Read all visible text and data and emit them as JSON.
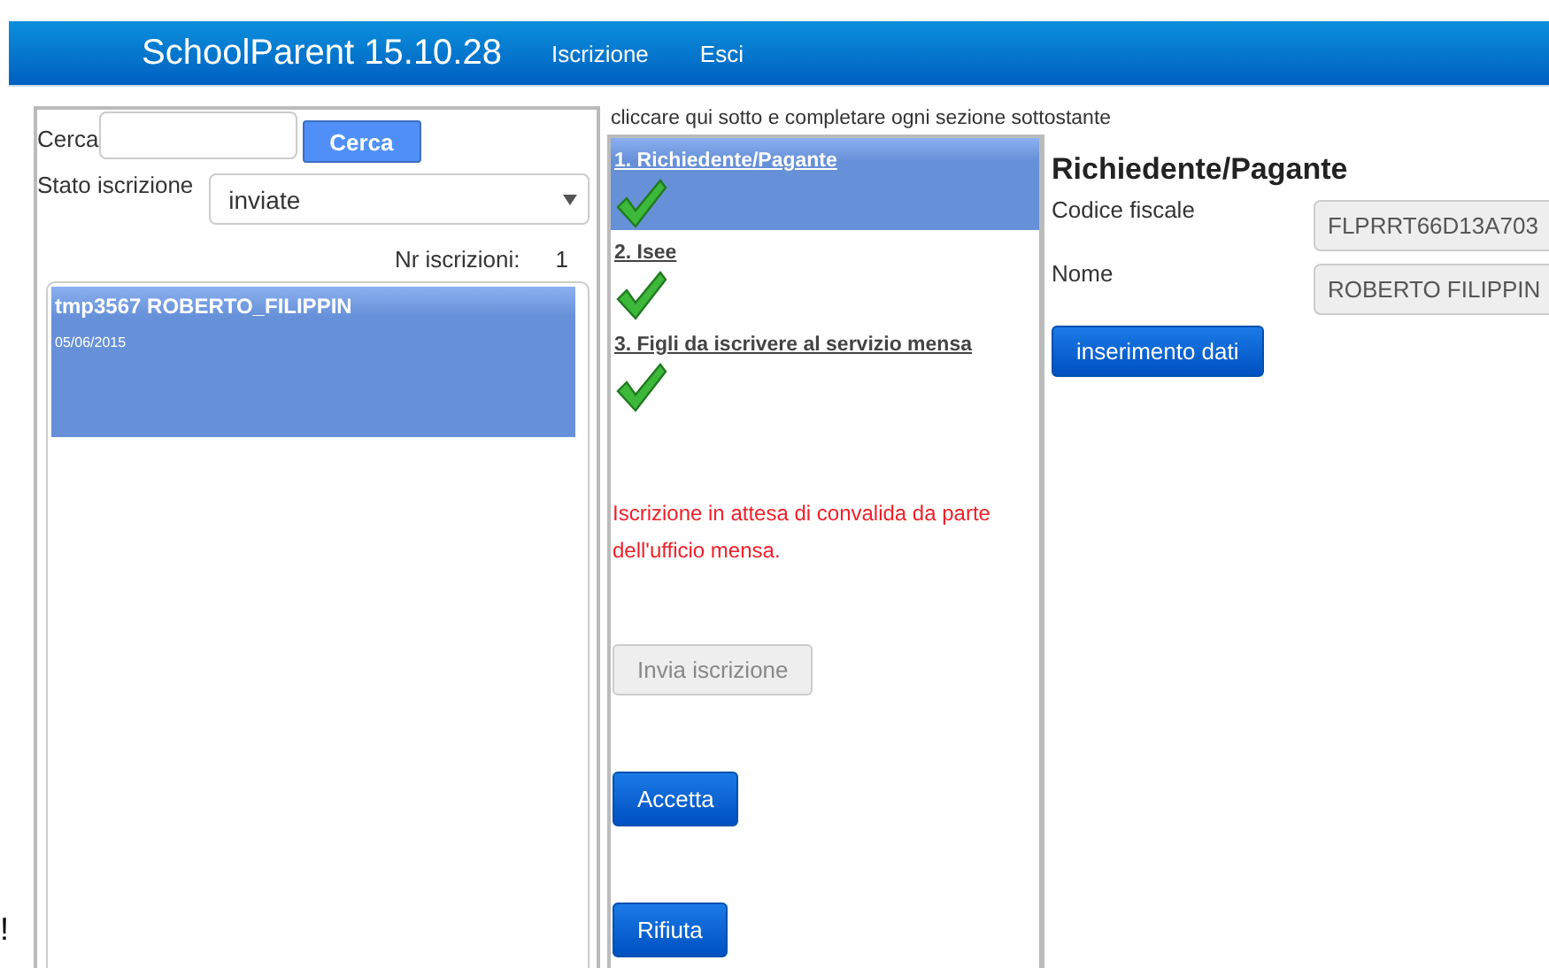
{
  "header": {
    "title": "SchoolParent 15.10.28",
    "nav": [
      {
        "label": "Iscrizione"
      },
      {
        "label": "Esci"
      }
    ]
  },
  "edge_text": "!",
  "left_panel": {
    "search": {
      "label": "Cerca",
      "button": "Cerca"
    },
    "status_filter": {
      "label": "Stato iscrizione",
      "value": "inviate"
    },
    "count": {
      "label": "Nr iscrizioni:",
      "value": "1"
    },
    "registrations": [
      {
        "title": "tmp3567 ROBERTO_FILIPPIN",
        "date": "05/06/2015",
        "selected": true
      }
    ]
  },
  "steps_panel": {
    "instruction": "cliccare qui sotto e completare ogni sezione sottostante",
    "steps": [
      {
        "title": "1. Richiedente/Pagante",
        "selected": true,
        "done": true
      },
      {
        "title": "2. Isee",
        "selected": false,
        "done": true
      },
      {
        "title": "3. Figli da iscrivere al servizio mensa",
        "selected": false,
        "done": true
      }
    ],
    "message": "Iscrizione in attesa di convalida da parte dell'ufficio mensa.",
    "buttons": [
      {
        "label": "Invia iscrizione",
        "disabled": true
      },
      {
        "label": "Accetta",
        "disabled": false
      },
      {
        "label": "Rifiuta",
        "disabled": false
      }
    ]
  },
  "detail": {
    "title": "Richiedente/Pagante",
    "fields": [
      {
        "label": "Codice fiscale",
        "value": "FLPRRT66D13A703"
      },
      {
        "label": "Nome",
        "value": "ROBERTO FILIPPIN"
      }
    ],
    "button": "inserimento dati"
  }
}
